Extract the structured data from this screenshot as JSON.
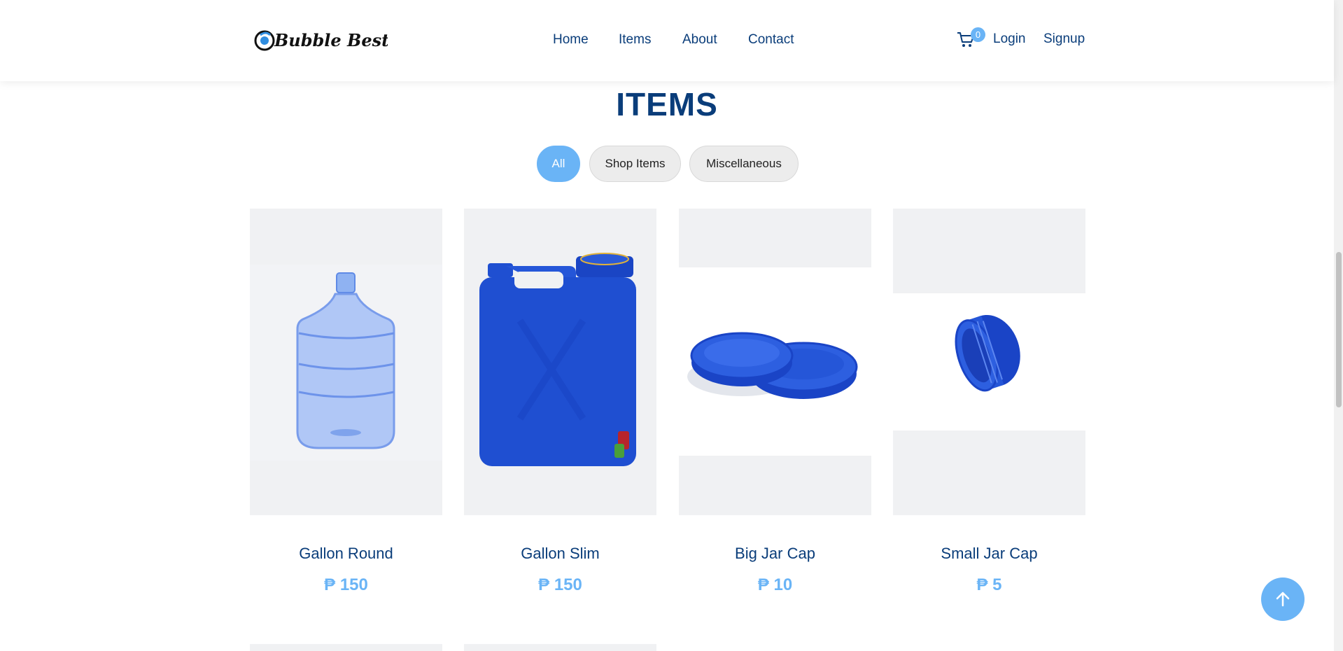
{
  "brand": {
    "logo_text": "Bubble Best"
  },
  "nav": {
    "home": "Home",
    "items": "Items",
    "about": "About",
    "contact": "Contact"
  },
  "cart": {
    "count": "0"
  },
  "auth": {
    "login": "Login",
    "signup": "Signup"
  },
  "page": {
    "title": "ITEMS"
  },
  "filters": [
    {
      "label": "All",
      "active": true
    },
    {
      "label": "Shop Items",
      "active": false
    },
    {
      "label": "Miscellaneous",
      "active": false
    }
  ],
  "products": [
    {
      "name": "Gallon Round",
      "price": "₱ 150"
    },
    {
      "name": "Gallon Slim",
      "price": "₱ 150"
    },
    {
      "name": "Big Jar Cap",
      "price": "₱ 10"
    },
    {
      "name": "Small Jar Cap",
      "price": "₱ 5"
    }
  ],
  "colors": {
    "primary": "#0a3d7a",
    "accent": "#6ab4f6",
    "product_blue": "#1f4fd1"
  },
  "icons": [
    "cart-icon",
    "arrow-up-icon"
  ]
}
